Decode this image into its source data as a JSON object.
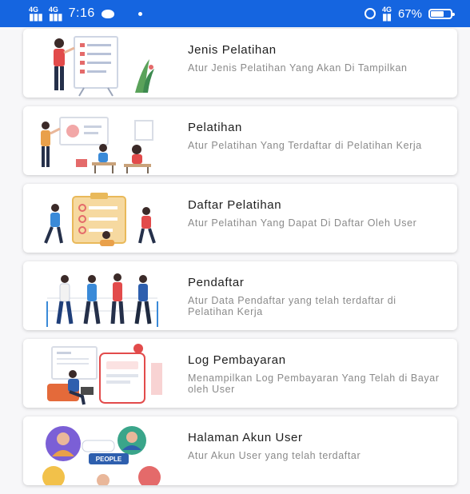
{
  "status_bar": {
    "signal_1": "4G",
    "signal_2": "4G",
    "time": "7:16",
    "network_right": "4G",
    "battery_text": "67%",
    "battery_level": 0.67,
    "bg_color": "#1565e0"
  },
  "menu": [
    {
      "title": "Jenis Pelatihan",
      "description": "Atur Jenis Pelatihan Yang Akan Di Tampilkan",
      "icon": "presentation-board-illustration"
    },
    {
      "title": "Pelatihan",
      "description": "Atur Pelatihan Yang Terdaftar di Pelatihan Kerja",
      "icon": "training-class-illustration"
    },
    {
      "title": "Daftar Pelatihan",
      "description": "Atur Pelatihan Yang Dapat Di Daftar Oleh User",
      "icon": "checklist-clipboard-illustration"
    },
    {
      "title": "Pendaftar",
      "description": "Atur Data Pendaftar yang telah terdaftar di Pelatihan Kerja",
      "icon": "registrants-group-illustration"
    },
    {
      "title": "Log Pembayaran",
      "description": "Menampilkan Log Pembayaran Yang Telah di Bayar oleh User",
      "icon": "payment-log-illustration"
    },
    {
      "title": "Halaman Akun User",
      "description": "Atur Akun User yang telah terdaftar",
      "icon": "user-accounts-illustration",
      "illustration_text": "PEOPLE"
    }
  ]
}
